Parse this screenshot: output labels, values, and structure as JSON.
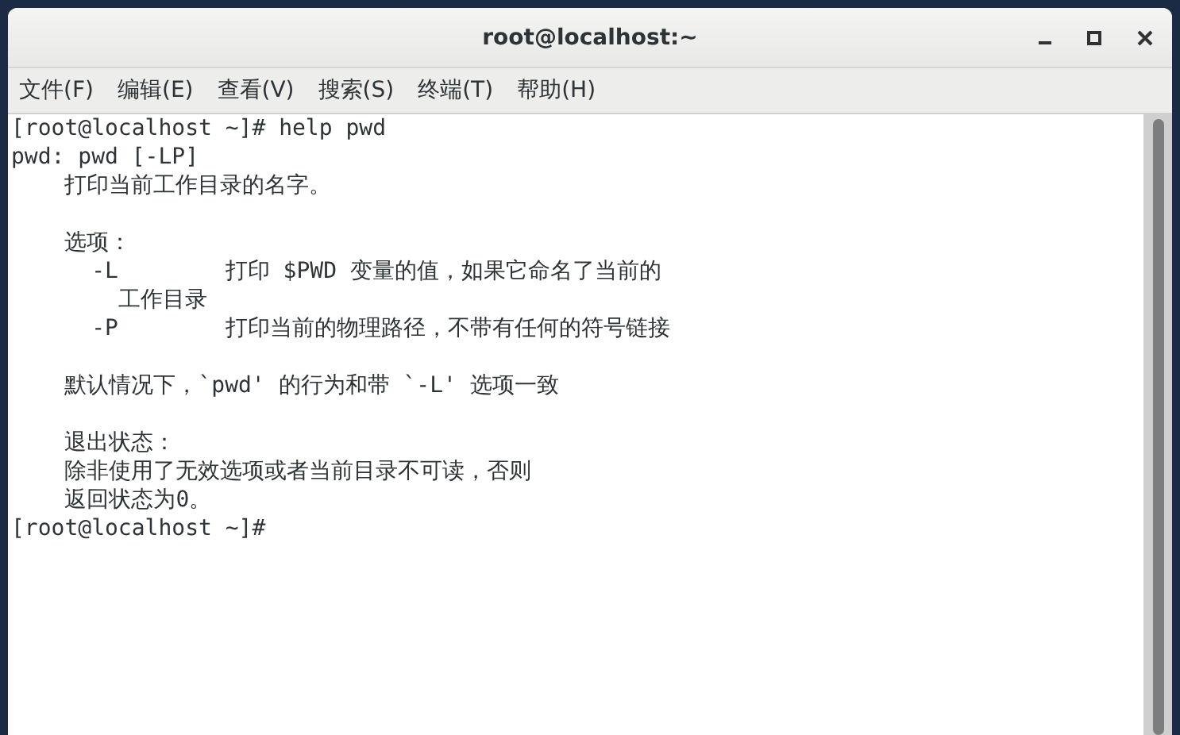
{
  "window": {
    "title": "root@localhost:~"
  },
  "menu": [
    {
      "label": "文件(F)"
    },
    {
      "label": "编辑(E)"
    },
    {
      "label": "查看(V)"
    },
    {
      "label": "搜索(S)"
    },
    {
      "label": "终端(T)"
    },
    {
      "label": "帮助(H)"
    }
  ],
  "terminal": {
    "blocks": [
      {
        "lines": [
          "[root@localhost ~]# help pwd",
          "pwd: pwd [-LP]",
          "    打印当前工作目录的名字。"
        ]
      },
      {
        "lines": [
          "    选项：",
          "      -L        打印 $PWD 变量的值，如果它命名了当前的",
          "        工作目录",
          "      -P        打印当前的物理路径，不带有任何的符号链接"
        ]
      },
      {
        "lines": [
          "    默认情况下，`pwd' 的行为和带 `-L' 选项一致"
        ]
      },
      {
        "lines": [
          "    退出状态：",
          "    除非使用了无效选项或者当前目录不可读，否则",
          "    返回状态为0。",
          "[root@localhost ~]#"
        ]
      }
    ]
  }
}
